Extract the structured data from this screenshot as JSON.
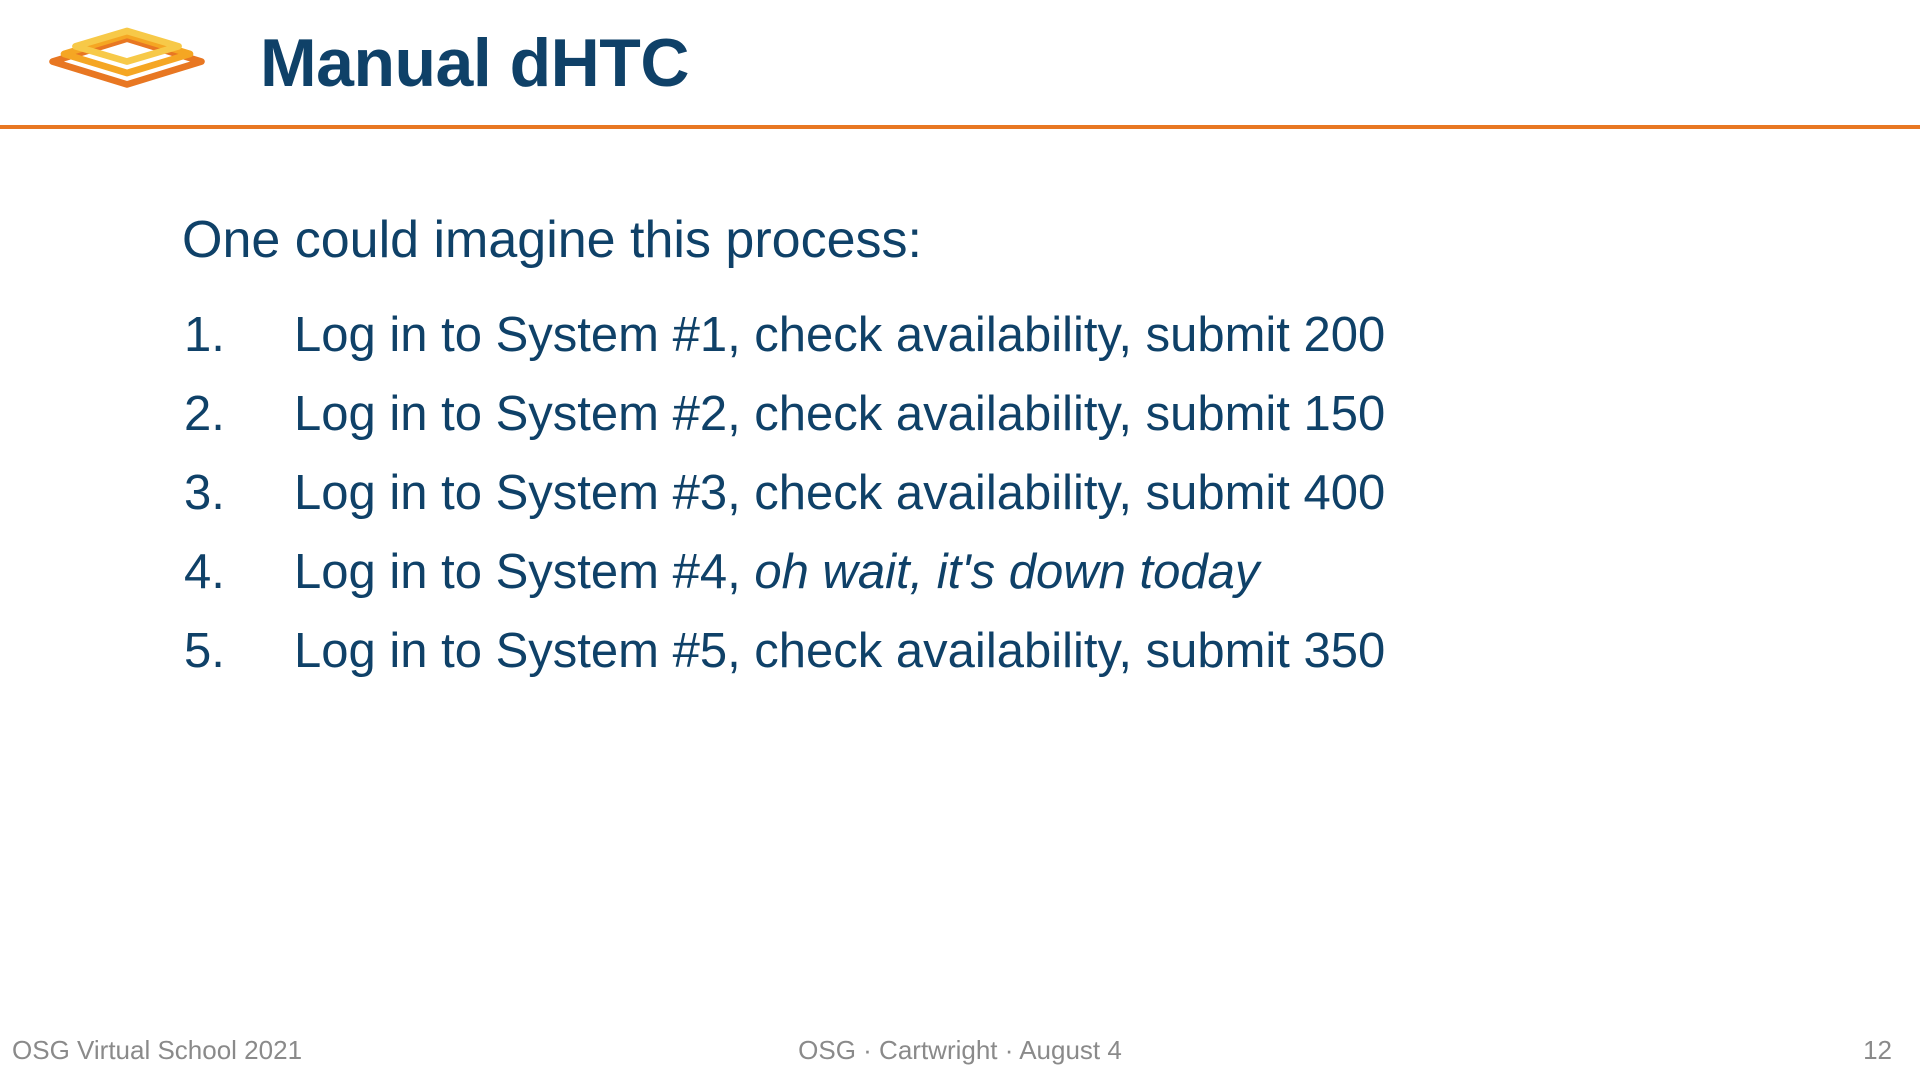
{
  "header": {
    "title": "Manual dHTC"
  },
  "body": {
    "intro": "One could imagine this process:",
    "steps": [
      {
        "num": "1.",
        "text_before": "Log in to System #1, check availability, submit 200",
        "text_italic": "",
        "text_after": ""
      },
      {
        "num": "2.",
        "text_before": "Log in to System #2, check availability, submit 150",
        "text_italic": "",
        "text_after": ""
      },
      {
        "num": "3.",
        "text_before": "Log in to System #3, check availability, submit 400",
        "text_italic": "",
        "text_after": ""
      },
      {
        "num": "4.",
        "text_before": "Log in to System #4, ",
        "text_italic": "oh wait, it's down today",
        "text_after": ""
      },
      {
        "num": "5.",
        "text_before": "Log in to System #5, check availability, submit 350",
        "text_italic": "",
        "text_after": ""
      }
    ]
  },
  "footer": {
    "left": "OSG Virtual School 2021",
    "center": "OSG  ·  Cartwright  ·  August 4",
    "right": "12"
  }
}
